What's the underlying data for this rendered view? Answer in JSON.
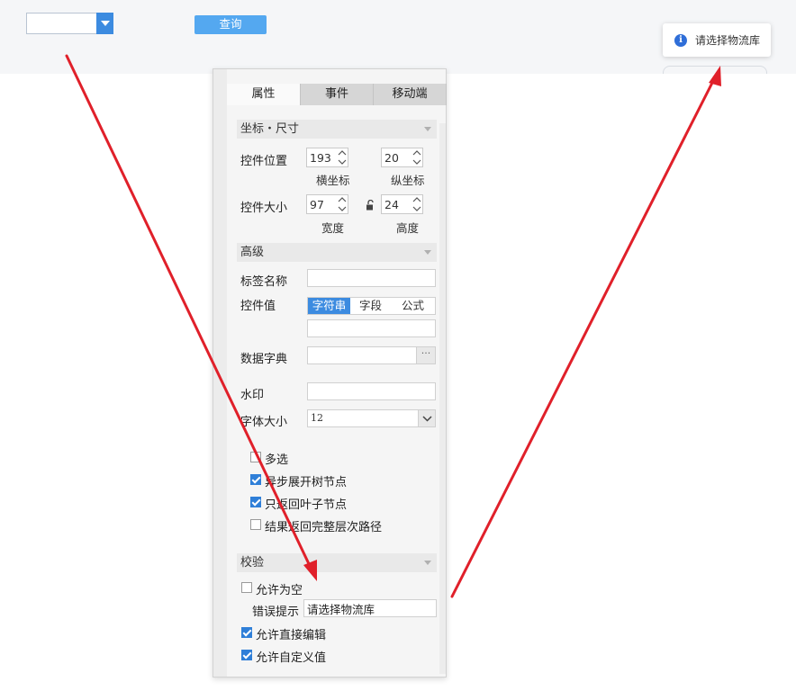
{
  "topbar": {
    "query_label": "查询"
  },
  "toast": {
    "message": "请选择物流库"
  },
  "panel": {
    "tabs": [
      {
        "label": "属性"
      },
      {
        "label": "事件"
      },
      {
        "label": "移动端"
      }
    ],
    "sections": {
      "coords": "坐标・尺寸",
      "advanced": "高级",
      "validation": "校验"
    },
    "position": {
      "label": "控件位置",
      "x_value": "193",
      "x_label": "横坐标",
      "y_value": "20",
      "y_label": "纵坐标"
    },
    "size": {
      "label": "控件大小",
      "w_value": "97",
      "w_label": "宽度",
      "h_value": "24",
      "h_label": "高度"
    },
    "tag_name": {
      "label": "标签名称",
      "value": ""
    },
    "widget_value": {
      "label": "控件值",
      "options": [
        "字符串",
        "字段",
        "公式"
      ],
      "selected": "字符串",
      "value": ""
    },
    "dictionary": {
      "label": "数据字典",
      "value": "",
      "button": "···"
    },
    "watermark": {
      "label": "水印",
      "value": ""
    },
    "font_size": {
      "label": "字体大小",
      "value": "12"
    },
    "options": [
      {
        "label": "多选",
        "checked": false
      },
      {
        "label": "异步展开树节点",
        "checked": true
      },
      {
        "label": "只返回叶子节点",
        "checked": true
      },
      {
        "label": "结果返回完整层次路径",
        "checked": false
      }
    ],
    "validation": {
      "allow_empty": {
        "label": "允许为空",
        "checked": false
      },
      "error_tip": {
        "label": "错误提示",
        "value": "请选择物流库"
      },
      "allow_edit": {
        "label": "允许直接编辑",
        "checked": true
      },
      "allow_custom": {
        "label": "允许自定义值",
        "checked": true
      }
    }
  },
  "colors": {
    "accent": "#3c8be0",
    "arrow": "#e0202a",
    "query_button": "#54a8f0"
  }
}
